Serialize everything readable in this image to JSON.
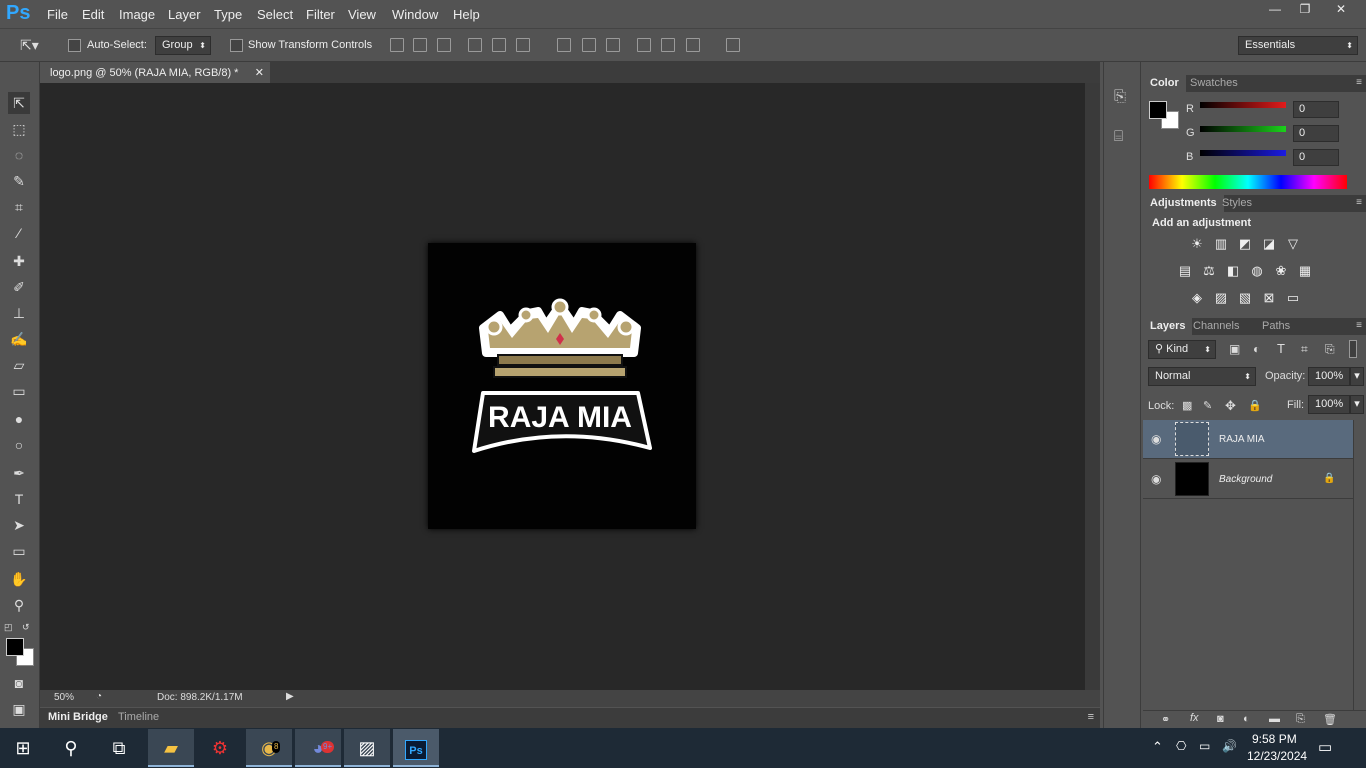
{
  "app": {
    "logo": "Ps"
  },
  "menu": [
    "File",
    "Edit",
    "Image",
    "Layer",
    "Type",
    "Select",
    "Filter",
    "View",
    "Window",
    "Help"
  ],
  "window_controls": {
    "minimize": "—",
    "restore": "❐",
    "close": "✕"
  },
  "options": {
    "auto_select_label": "Auto-Select:",
    "auto_select_value": "Group",
    "show_transform_label": "Show Transform Controls",
    "workspace": "Essentials"
  },
  "document": {
    "tab_title": "logo.png @ 50% (RAJA MIA, RGB/8) *",
    "zoom": "50%",
    "doc_info": "Doc: 898.2K/1.17M",
    "logo_text": "RAJA MIA"
  },
  "mini_bridge": {
    "tabs": [
      "Mini Bridge",
      "Timeline"
    ]
  },
  "color_panel": {
    "tabs": [
      "Color",
      "Swatches"
    ],
    "channels": [
      {
        "label": "R",
        "value": "0",
        "color": "#e21b1b"
      },
      {
        "label": "G",
        "value": "0",
        "color": "#1bd21b"
      },
      {
        "label": "B",
        "value": "0",
        "color": "#1b1be2"
      }
    ]
  },
  "adjustments_panel": {
    "tabs": [
      "Adjustments",
      "Styles"
    ],
    "heading": "Add an adjustment",
    "row1": [
      "brightness-icon",
      "levels-icon",
      "curves-icon",
      "exposure-icon",
      "vibrance-icon"
    ],
    "row2": [
      "hue-saturation-icon",
      "color-balance-icon",
      "black-white-icon",
      "photo-filter-icon",
      "channel-mixer-icon",
      "color-lookup-icon"
    ],
    "row3": [
      "invert-icon",
      "posterize-icon",
      "threshold-icon",
      "selective-color-icon",
      "gradient-map-icon"
    ]
  },
  "layers_panel": {
    "tabs": [
      "Layers",
      "Channels",
      "Paths"
    ],
    "kind": "Kind",
    "blend_mode": "Normal",
    "opacity_label": "Opacity:",
    "opacity": "100%",
    "lock_label": "Lock:",
    "fill_label": "Fill:",
    "fill": "100%",
    "layers": [
      {
        "name": "RAJA MIA",
        "selected": true
      },
      {
        "name": "Background",
        "selected": false
      }
    ]
  },
  "taskbar": {
    "time": "9:58 PM",
    "date": "12/23/2024",
    "chrome_badge": "8",
    "discord_badge": "9+"
  }
}
